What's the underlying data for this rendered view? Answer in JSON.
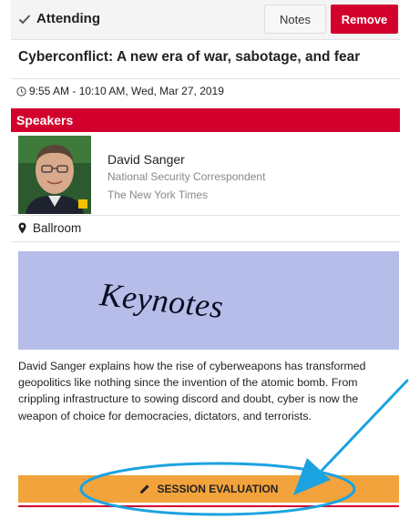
{
  "header": {
    "status_label": "Attending",
    "notes_label": "Notes",
    "remove_label": "Remove"
  },
  "session": {
    "title": "Cyberconflict: A new era of war, sabotage, and fear",
    "time": "9:55 AM - 10:10 AM, Wed, Mar 27, 2019"
  },
  "speakers": {
    "heading": "Speakers",
    "items": [
      {
        "name": "David Sanger",
        "role": "National Security Correspondent",
        "organization": "The New York Times"
      }
    ]
  },
  "location": {
    "label": "Ballroom"
  },
  "banner": {
    "text": "Keynotes"
  },
  "description": "David Sanger explains how the rise of cyberweapons has transformed geopolitics like nothing since the invention of the atomic bomb. From crippling infrastructure to sowing discord and doubt, cyber is now the weapon of choice for democracies, dictators, and terrorists.",
  "evaluation": {
    "button_label": "SESSION EVALUATION"
  },
  "colors": {
    "accent_red": "#d2002c",
    "evaluation_orange": "#f2a33b",
    "banner_blue": "#b5bde8",
    "annotation_blue": "#1ba3e0"
  },
  "icons": {
    "status": "check-icon",
    "time": "clock-icon",
    "location": "map-pin-icon",
    "evaluation": "pencil-icon"
  }
}
